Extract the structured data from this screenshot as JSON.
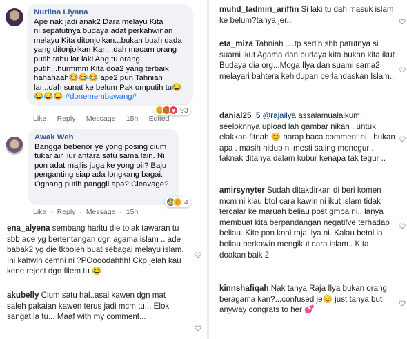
{
  "facebook": {
    "comments": [
      {
        "author": "Nurlina Liyana",
        "text": "Ape nak jadi anak2 Dara melayu Kita ni,sepatutnya budaya adat perkahwinan melayu Kita ditonjolkan...bukan buah dada yang ditonjolkan Kan...dah macam orang putih tahu lar laki Ang tu orang putih...hurmmm Kita doa2 yang terbaik hahahaah😂😂😂 ape2 pun Tahniah lar...dah sunat ke belum Pak omputih tu😂😂😂😂",
        "hashtag": "#donemembawang#",
        "actions": [
          "Like",
          "·",
          "Reply",
          "·",
          "Message",
          "·",
          "15h",
          "·",
          "Edited"
        ],
        "reaction_count": "93",
        "reactions": [
          "haha-icon",
          "angry-icon",
          "love-icon"
        ]
      },
      {
        "author": "Awak Weh",
        "text": "Bangga bebenor ye yong posing cium tukar air liur antara satu sama lain. Ni pon adat majlis juga ke yong oii? Baju penganting siap ada longkang bagai. Oghang putih panggil apa? Cleavage?",
        "actions": [
          "Like",
          "·",
          "Reply",
          "·",
          "Message",
          "·",
          "15h"
        ],
        "reaction_count": "4",
        "reactions": [
          "like-icon",
          "haha-icon"
        ]
      }
    ]
  },
  "instagram_left": [
    {
      "user": "ena_alyena",
      "text": "sembang haritu die tolak tawaran tu sbb ade yg bertentangan dgn agama islam .. ade babak2 yg die tkboleh buat sebagai melayu islam. Ini kahwin cemni ni ?POooodahhh! Ckp jelah kau kene reject dgn filem tu 😂"
    },
    {
      "user": "akubelly",
      "text": "Cium satu hal..asal kawen dgn mat saleh pakaian kawen terus jadi mcm tu... Elok sangat la tu... Maaf with my comment..."
    }
  ],
  "instagram_right": [
    {
      "user": "muhd_tadmiri_ariffin",
      "text": "Si laki tu dah masuk islam ke belum?tanya jer..."
    },
    {
      "user": "eta_miza",
      "text": "Tahniah ....tp sedih sbb patutnya si suami ikut Agama dan budaya kita bukan kita ikut Budaya dia org...Moga Ilya dan suami sama2 melayari bahtera kehidupan berlandaskan Islam.."
    },
    {
      "user": "danial25_5",
      "mention": "@rajailya",
      "text": "assalamualaikum. seeloknnya upload lah gambar nikah . untuk elakkan fitnah 😊 harap baca comment ni . bukan apa . masih hidup ni mesti saling menegur . taknak ditanya dalam kubur kenapa tak tegur .."
    },
    {
      "user": "amirsynyter",
      "text": "Sudah ditakdirkan di beri komen mcm ni klau btol cara kawin ni ikut islam tidak tercalar ke maruah beliau post gmba ni.. lanya membuat kita berpandangan negatifve terhadap beliau. Kite pon knal raja ilya ni. Kalau betol la beliau berkawin mengikut cara islam.. Kita doakan baik 2"
    },
    {
      "user": "kinnshafiqah",
      "text": "Nak tanya Raja Ilya bukan orang beragama kan?...confused je😊 just tanya but anyway congrats to her 💕"
    }
  ],
  "colors": {
    "fb_bubble": "#f0f2f5",
    "fb_author": "#385898",
    "ig_text": "#262626",
    "meta_gray": "#65676b"
  }
}
